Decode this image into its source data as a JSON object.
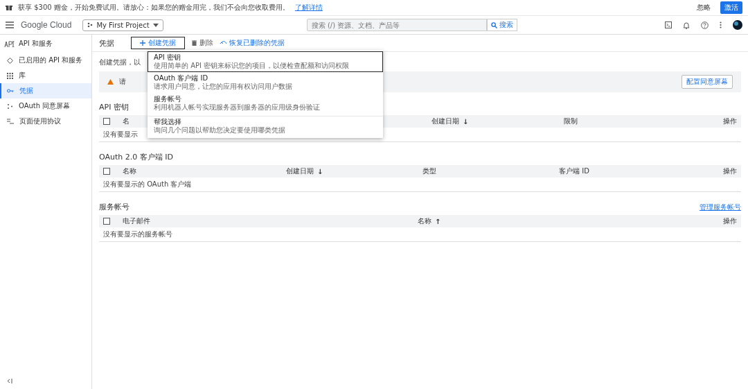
{
  "banner": {
    "text": "获享 $300 赠金，开始免费试用。请放心：如果您的赠金用完，我们不会向您收取费用。",
    "link": "了解详情",
    "buttons": [
      {
        "label": "忽略",
        "kind": "text"
      },
      {
        "label": "激活",
        "kind": "primary"
      }
    ]
  },
  "topbar": {
    "logo": "Google Cloud",
    "project": "My First Project",
    "search": {
      "placeholder": "搜索 (/) 资源、文档、产品等",
      "button": "搜索"
    }
  },
  "sidebar": {
    "title": "API 和服务",
    "items": [
      {
        "label": "已启用的 API 和服务",
        "selected": false
      },
      {
        "label": "库",
        "selected": false
      },
      {
        "label": "凭据",
        "selected": true
      },
      {
        "label": "OAuth 同意屏幕",
        "selected": false
      },
      {
        "label": "页面使用协议",
        "selected": false
      }
    ]
  },
  "toolbar": {
    "title": "凭据",
    "create": "创建凭据",
    "delete": "删除",
    "restore": "恢复已删除的凭据"
  },
  "intro": "创建凭据，以",
  "warning": {
    "text": "请",
    "button": "配置同意屏幕"
  },
  "menu": [
    {
      "title": "API 密钥",
      "desc": "使用简单的 API 密钥来标识您的项目，以便检查配额和访问权限",
      "selected": true
    },
    {
      "title": "OAuth 客户端 ID",
      "desc": "请求用户同意，让您的应用有权访问用户数据",
      "selected": false
    },
    {
      "title": "服务帐号",
      "desc": "利用机器人帐号实现服务器到服务器的应用级身份验证",
      "selected": false
    },
    {
      "title": "帮我选择",
      "desc": "询问几个问题以帮助您决定要使用哪类凭据",
      "selected": false
    }
  ],
  "sections": [
    {
      "title": "API 密钥",
      "columns": [
        {
          "label": "名"
        },
        {
          "label": "创建日期",
          "arrow": "↓"
        },
        {
          "label": "限制"
        },
        {
          "label": "操作"
        }
      ],
      "checked": false,
      "empty": "没有要显示"
    },
    {
      "title": "OAuth 2.0 客户端 ID",
      "columns": [
        {
          "label": "名称"
        },
        {
          "label": "创建日期",
          "arrow": "↓"
        },
        {
          "label": "类型"
        },
        {
          "label": "客户端 ID"
        },
        {
          "label": "操作"
        }
      ],
      "checked": false,
      "empty": "没有要显示的 OAuth 客户端"
    },
    {
      "title": "服务帐号",
      "link": "管理服务帐号",
      "columns": [
        {
          "label": "电子邮件"
        },
        {
          "label": "名称",
          "arrow": "↑"
        },
        {
          "label": "操作"
        }
      ],
      "checked": false,
      "empty": "没有要显示的服务帐号"
    }
  ]
}
